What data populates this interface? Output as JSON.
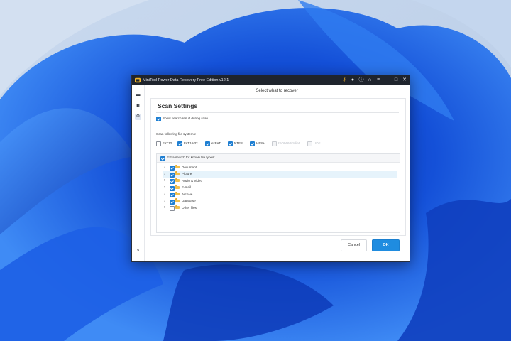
{
  "window": {
    "title": "MiniTool Power Data Recovery Free Edition v12.1",
    "header": "Select what to recover"
  },
  "titlebar_icons": [
    "key-icon",
    "bell-icon",
    "info-icon",
    "headset-icon",
    "menu-icon",
    "minimize-icon",
    "maximize-icon",
    "close-icon"
  ],
  "sidebar": {
    "icons": [
      "drive-icon",
      "folder-recovery-icon",
      "settings-icon",
      "expand-sidebar-icon"
    ]
  },
  "scan_settings": {
    "title": "Scan Settings",
    "show_search_result": {
      "label": "Show search result during scan",
      "checked": true
    },
    "fs_label": "Scan following file systems:",
    "file_systems": [
      {
        "label": "FAT12",
        "checked": false,
        "disabled": false
      },
      {
        "label": "FAT16/32",
        "checked": true,
        "disabled": false
      },
      {
        "label": "exFAT",
        "checked": true,
        "disabled": false
      },
      {
        "label": "NTFS",
        "checked": true,
        "disabled": false
      },
      {
        "label": "HFS+",
        "checked": true,
        "disabled": false
      },
      {
        "label": "ISO9660/Joliet",
        "checked": false,
        "disabled": true
      },
      {
        "label": "UDF",
        "checked": false,
        "disabled": true
      }
    ],
    "extra_search": {
      "label": "Extra search for known file types:",
      "checked": true
    },
    "file_types": [
      {
        "label": "Document",
        "checked": true
      },
      {
        "label": "Picture",
        "checked": true
      },
      {
        "label": "Audio & Video",
        "checked": true
      },
      {
        "label": "E-mail",
        "checked": true
      },
      {
        "label": "Archive",
        "checked": true
      },
      {
        "label": "Database",
        "checked": true
      },
      {
        "label": "Other files",
        "checked": false
      }
    ]
  },
  "buttons": {
    "cancel": "Cancel",
    "ok": "OK"
  },
  "colors": {
    "accent": "#1f8ce0",
    "titlebar": "#1f242d",
    "wallpaper": "#1a5fe0"
  }
}
